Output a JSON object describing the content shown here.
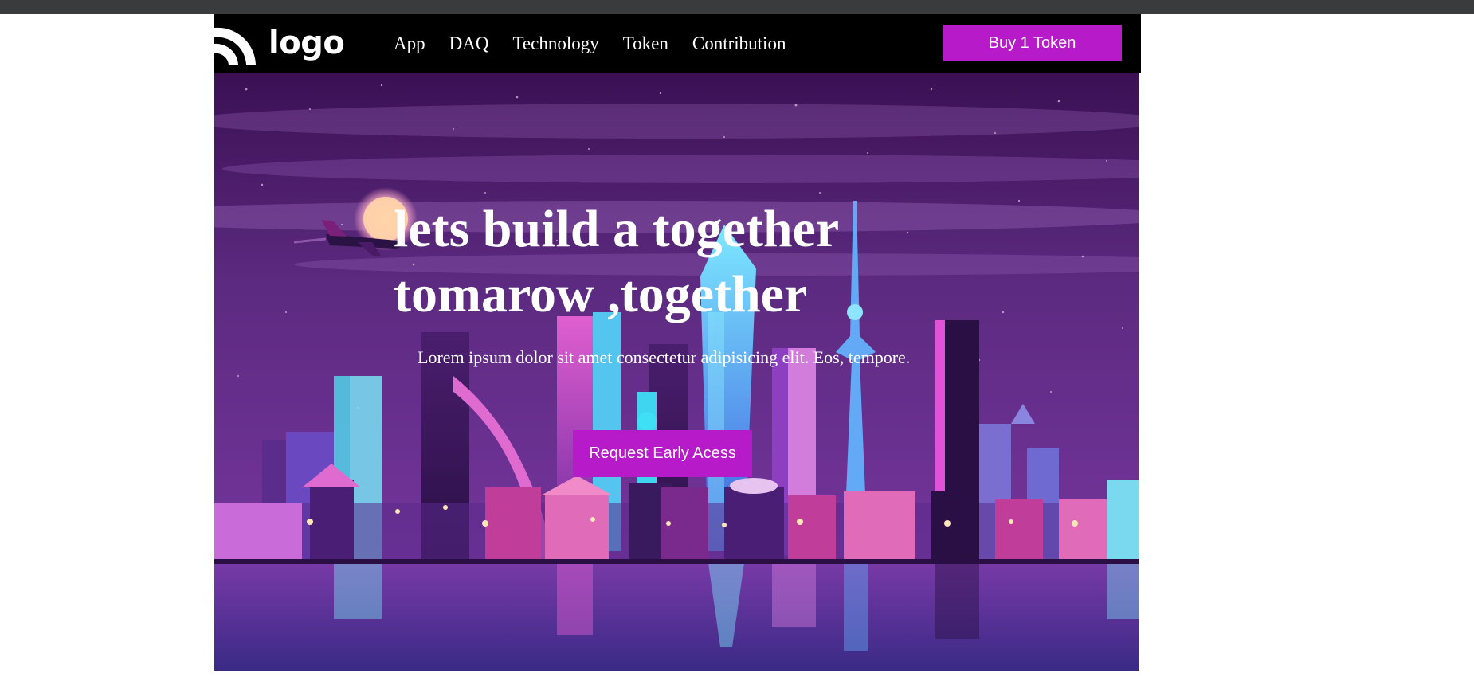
{
  "header": {
    "logo_text": "logo",
    "logo_icon": "wifi-arcs-icon",
    "nav": [
      {
        "label": "App"
      },
      {
        "label": "DAQ"
      },
      {
        "label": "Technology"
      },
      {
        "label": "Token"
      },
      {
        "label": "Contribution"
      }
    ],
    "buy_label": "Buy 1 Token"
  },
  "hero": {
    "title_line1": "lets build a together",
    "title_line2": "tomarow ,together",
    "subtitle": "Lorem ipsum dolor sit amet consectetur adipisicing elit. Eos, tempore.",
    "cta_label": "Request Early Acess",
    "illustration": "neon-city-skyline-night"
  },
  "colors": {
    "navbar_bg": "#000000",
    "button_bg": "#b71bc9",
    "text": "#ffffff",
    "sky_top": "#3b1053",
    "sky_mid": "#6a2e8c"
  }
}
